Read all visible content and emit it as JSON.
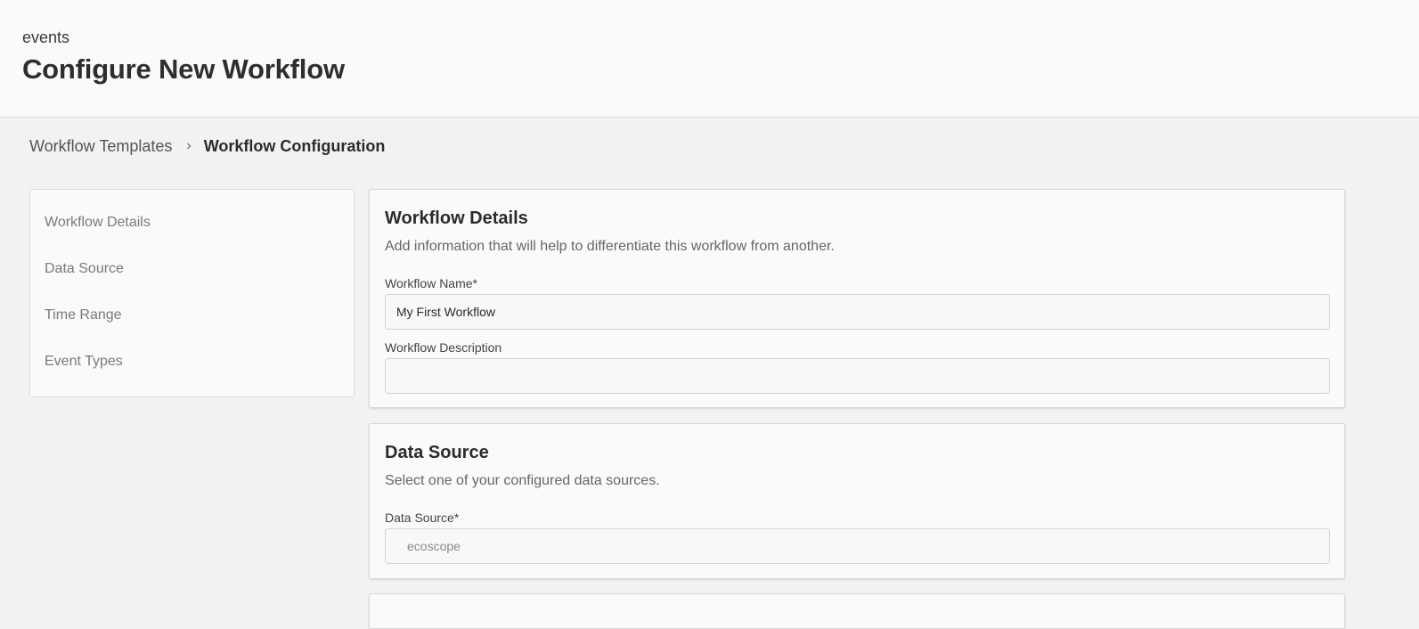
{
  "header": {
    "app_name": "events",
    "title": "Configure New Workflow"
  },
  "breadcrumb": {
    "parent": "Workflow Templates",
    "separator": "›",
    "current": "Workflow Configuration"
  },
  "sidebar": {
    "items": [
      {
        "label": "Workflow Details"
      },
      {
        "label": "Data Source"
      },
      {
        "label": "Time Range"
      },
      {
        "label": "Event Types"
      }
    ]
  },
  "workflow_details": {
    "title": "Workflow Details",
    "description": "Add information that will help to differentiate this workflow from another.",
    "name_label": "Workflow Name*",
    "name_value": "My First Workflow",
    "description_label": "Workflow Description",
    "description_value": ""
  },
  "data_source": {
    "title": "Data Source",
    "description": "Select one of your configured data sources.",
    "field_label": "Data Source*",
    "selected_value": "ecoscope"
  }
}
